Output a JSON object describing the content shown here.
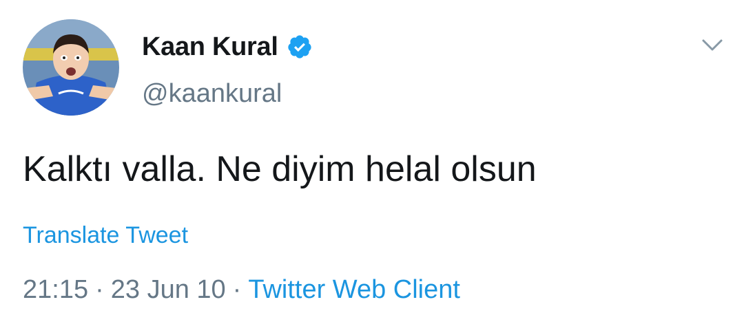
{
  "author": {
    "display_name": "Kaan Kural",
    "handle": "@kaankural",
    "verified": true,
    "avatar_icon": "profile-photo"
  },
  "tweet": {
    "text": "Kalktı valla. Ne diyim helal olsun",
    "translate_label": "Translate Tweet",
    "time": "21:15",
    "date": "23 Jun 10",
    "separator": "·",
    "source": "Twitter Web Client"
  },
  "icons": {
    "verified": "verified-badge-icon",
    "menu": "chevron-down-icon"
  },
  "colors": {
    "text_primary": "#14171a",
    "text_secondary": "#657786",
    "link": "#1b95e0",
    "verified_badge": "#1da1f2"
  }
}
